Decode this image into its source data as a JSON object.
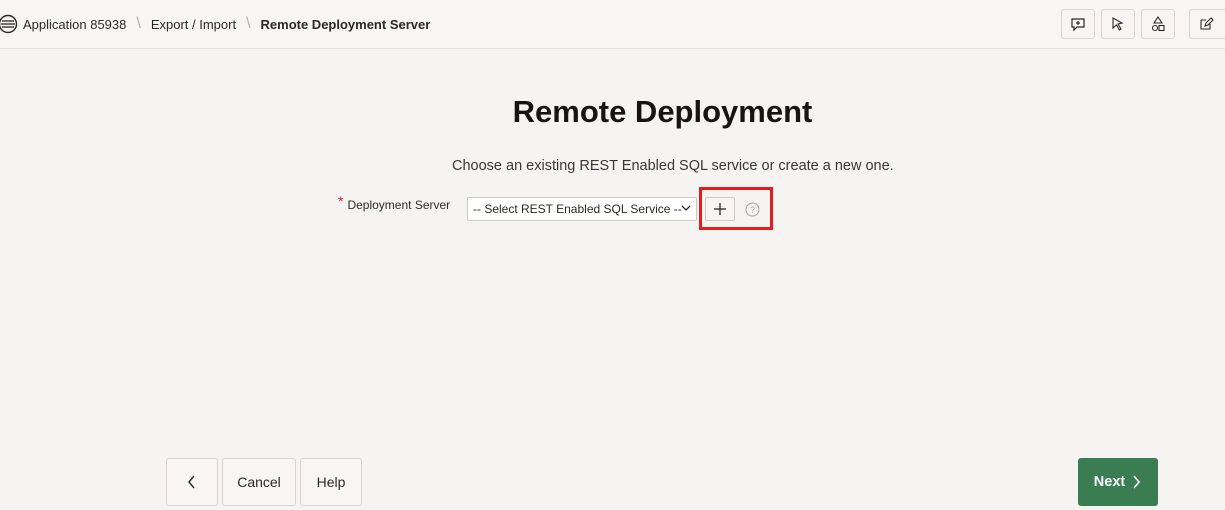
{
  "breadcrumb": {
    "items": [
      "Application 85938",
      "Export / Import",
      "Remote Deployment Server"
    ]
  },
  "toolbar": {
    "icons": [
      "comment-icon",
      "cursor-icon",
      "shapes-icon",
      "edit-icon"
    ]
  },
  "main": {
    "title": "Remote Deployment",
    "subtitle": "Choose an existing REST Enabled SQL service or create a new one.",
    "field": {
      "required_mark": "*",
      "label": "Deployment Server",
      "select_value": "-- Select REST Enabled SQL Service --"
    }
  },
  "footer": {
    "cancel_label": "Cancel",
    "help_label": "Help",
    "next_label": "Next"
  },
  "colors": {
    "accent_green": "#3a7d52",
    "highlight_red": "#e31c1c",
    "required_red": "#d0211b"
  }
}
